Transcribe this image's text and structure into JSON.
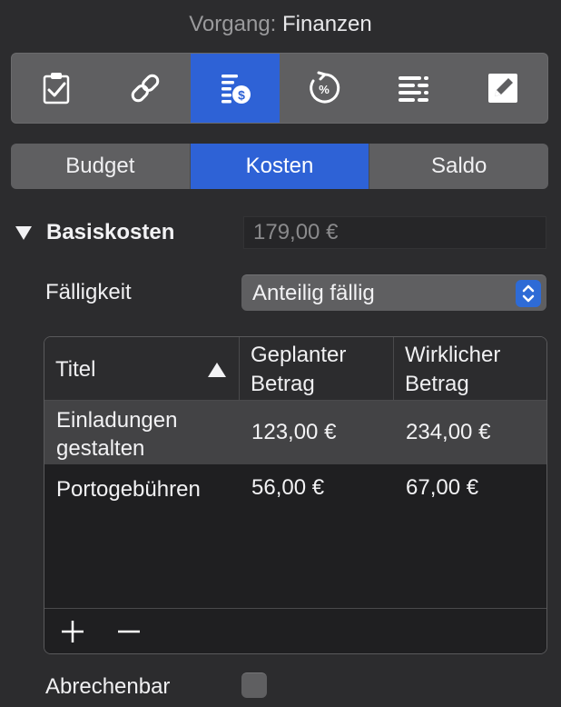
{
  "header": {
    "label": "Vorgang:",
    "value": "Finanzen"
  },
  "toolbar": {
    "icons": [
      {
        "name": "clipboard-check-icon",
        "active": false
      },
      {
        "name": "link-icon",
        "active": false
      },
      {
        "name": "finance-icon",
        "active": true
      },
      {
        "name": "percent-progress-icon",
        "active": false
      },
      {
        "name": "list-icon",
        "active": false
      },
      {
        "name": "pencil-note-icon",
        "active": false
      }
    ]
  },
  "tabs": [
    {
      "label": "Budget",
      "active": false
    },
    {
      "label": "Kosten",
      "active": true
    },
    {
      "label": "Saldo",
      "active": false
    }
  ],
  "basis": {
    "title": "Basiskosten",
    "value": "179,00 €"
  },
  "due": {
    "label": "Fälligkeit",
    "selected": "Anteilig fällig"
  },
  "table": {
    "headers": {
      "title": "Titel",
      "planned_line1": "Geplanter",
      "planned_line2": "Betrag",
      "actual_line1": "Wirklicher",
      "actual_line2": "Betrag"
    },
    "rows": [
      {
        "title_line1": "Einladungen",
        "title_line2": "gestalten",
        "planned": "123,00 €",
        "actual": "234,00 €"
      },
      {
        "title_line1": "Portogebühren",
        "title_line2": "",
        "planned": "56,00 €",
        "actual": "67,00 €"
      }
    ]
  },
  "billable": {
    "label": "Abrechenbar",
    "checked": false
  },
  "colors": {
    "accent": "#2e62d6",
    "background": "#2c2c2e",
    "button": "#5f5f61"
  }
}
